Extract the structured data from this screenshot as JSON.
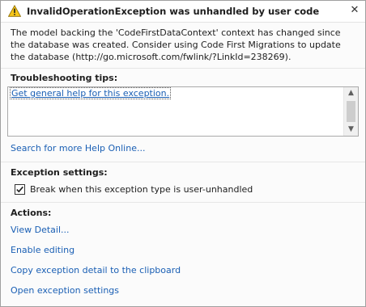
{
  "dialog": {
    "title": "InvalidOperationException was unhandled by user code",
    "close_glyph": "✕",
    "message": "The model backing the 'CodeFirstDataContext' context has changed since the database was created. Consider using Code First Migrations to update the database (http://go.microsoft.com/fwlink/?LinkId=238269)."
  },
  "troubleshooting": {
    "heading": "Troubleshooting tips:",
    "tips": [
      "Get general help for this exception."
    ],
    "search_link": "Search for more Help Online..."
  },
  "exception_settings": {
    "heading": "Exception settings:",
    "checkbox_label": "Break when this exception type is user-unhandled",
    "checked": true
  },
  "actions": {
    "heading": "Actions:",
    "items": [
      "View Detail...",
      "Enable editing",
      "Copy exception detail to the clipboard",
      "Open exception settings"
    ]
  },
  "colors": {
    "link": "#1a5fb4",
    "warning_fill": "#f5c518"
  }
}
